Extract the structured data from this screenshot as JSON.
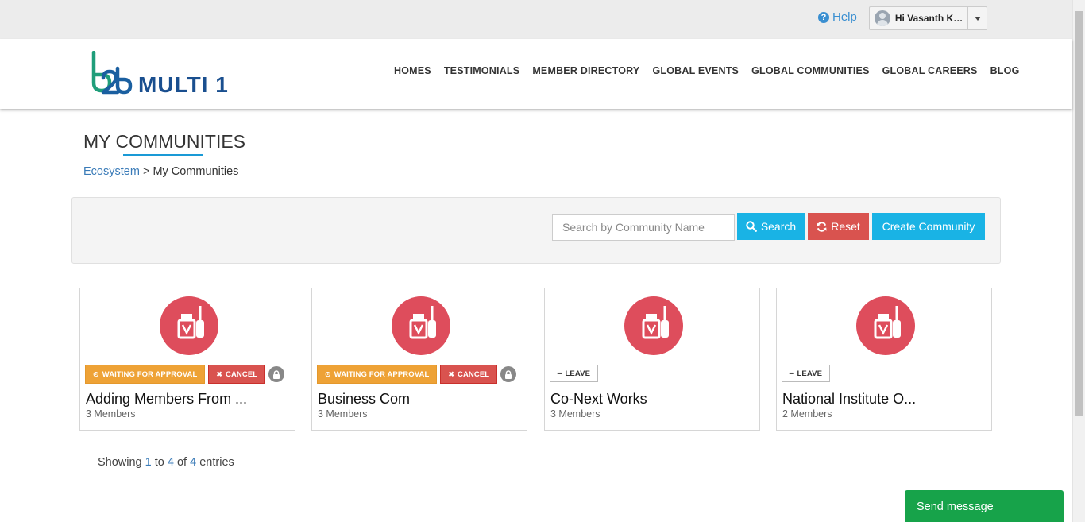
{
  "topbar": {
    "help_label": "Help",
    "user_label": "Hi Vasanth Kumar"
  },
  "header": {
    "logo_mark": "b2b",
    "logo_text": "MULTI 1",
    "nav": [
      {
        "label": "HOMES"
      },
      {
        "label": "TESTIMONIALS"
      },
      {
        "label": "MEMBER DIRECTORY"
      },
      {
        "label": "GLOBAL EVENTS"
      },
      {
        "label": "GLOBAL COMMUNITIES"
      },
      {
        "label": "GLOBAL CAREERS"
      },
      {
        "label": "BLOG"
      }
    ]
  },
  "page": {
    "title": "MY COMMUNITIES",
    "breadcrumb_root": "Ecosystem",
    "breadcrumb_sep": " > ",
    "breadcrumb_current": "My Communities"
  },
  "search": {
    "placeholder": "Search by Community Name",
    "search_label": "Search",
    "reset_label": "Reset",
    "create_label": "Create Community"
  },
  "communities": [
    {
      "name": "Adding Members From ...",
      "members": "3 Members",
      "status": "WAITING FOR APPROVAL",
      "action": "CANCEL",
      "locked": true
    },
    {
      "name": "Business Com",
      "members": "3 Members",
      "status": "WAITING FOR APPROVAL",
      "action": "CANCEL",
      "locked": true
    },
    {
      "name": "Co-Next Works",
      "members": "3 Members",
      "action": "LEAVE",
      "locked": false
    },
    {
      "name": "National Institute O...",
      "members": "2 Members",
      "action": "LEAVE",
      "locked": false
    }
  ],
  "pagination": {
    "prefix": "Showing ",
    "from": "1",
    "mid1": " to ",
    "to": "4",
    "mid2": " of ",
    "total": "4",
    "suffix": " entries"
  },
  "chat": {
    "label": "Send message"
  },
  "colors": {
    "accent": "#19b3e5",
    "danger": "#d9534f",
    "warning": "#eea236",
    "community_icon": "#de4d5c",
    "chat": "#17a34a"
  }
}
